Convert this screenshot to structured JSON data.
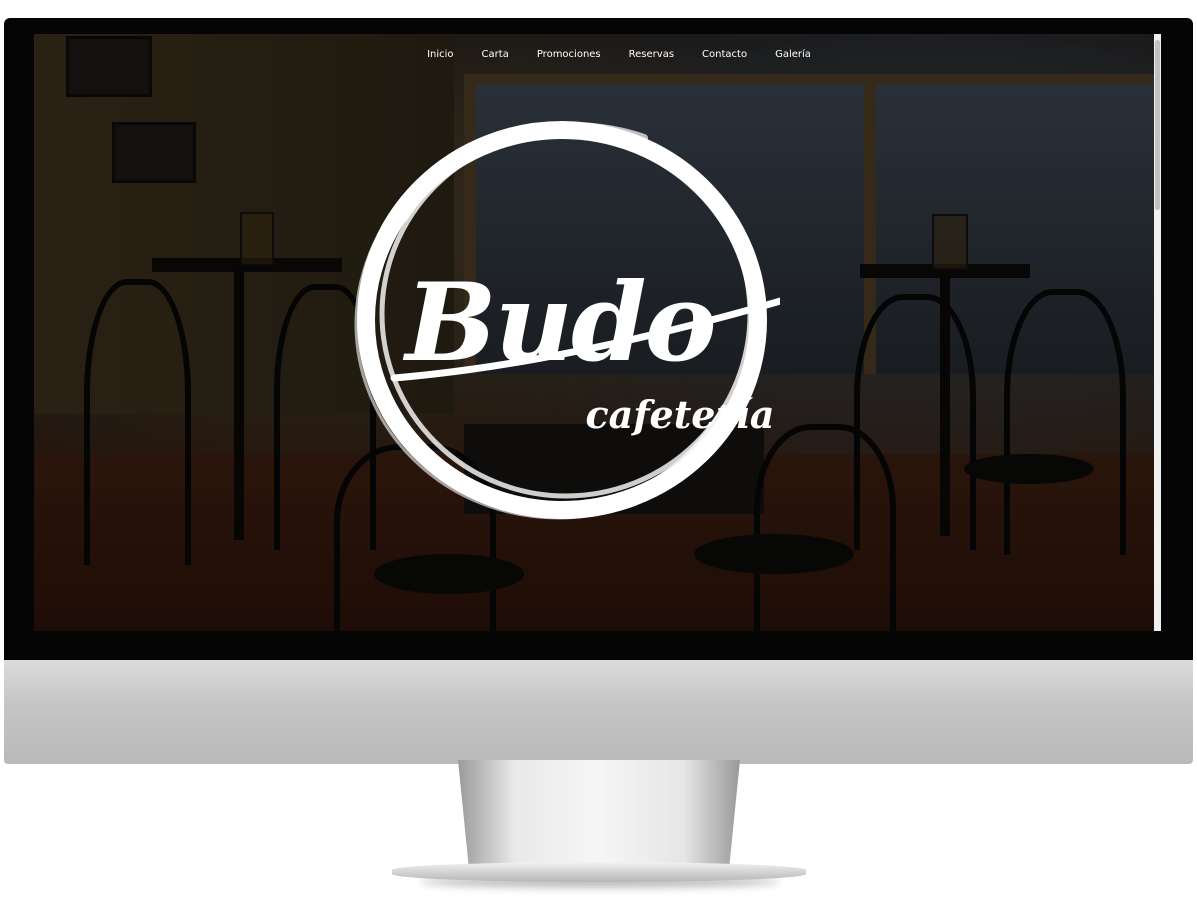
{
  "nav": {
    "items": [
      "Inicio",
      "Carta",
      "Promociones",
      "Reservas",
      "Contacto",
      "Galería"
    ]
  },
  "logo": {
    "main": "Budo",
    "sub": "cafetería"
  },
  "icons": [
    "budo-logo-emblem"
  ]
}
